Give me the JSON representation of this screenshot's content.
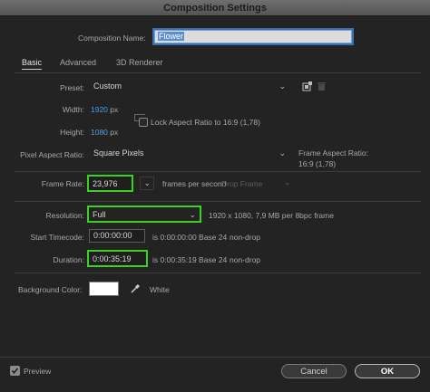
{
  "window": {
    "title": "Composition Settings"
  },
  "composition_name": {
    "label": "Composition Name:",
    "value": "Flower"
  },
  "tabs": [
    {
      "label": "Basic",
      "active": true
    },
    {
      "label": "Advanced",
      "active": false
    },
    {
      "label": "3D Renderer",
      "active": false
    }
  ],
  "preset": {
    "label": "Preset:",
    "value": "Custom"
  },
  "width": {
    "label": "Width:",
    "value": "1920",
    "unit": "px"
  },
  "height": {
    "label": "Height:",
    "value": "1080",
    "unit": "px"
  },
  "lock_aspect": {
    "label": "Lock Aspect Ratio to 16:9 (1,78)",
    "checked": false
  },
  "pixel_aspect": {
    "label": "Pixel Aspect Ratio:",
    "value": "Square Pixels"
  },
  "frame_aspect": {
    "label": "Frame Aspect Ratio:",
    "value": "16:9 (1,78)"
  },
  "frame_rate": {
    "label": "Frame Rate:",
    "value": "23,976",
    "unit": "frames per second",
    "drop_frame": "Drop Frame"
  },
  "resolution": {
    "label": "Resolution:",
    "value": "Full",
    "info": "1920 x 1080, 7,9 MB per 8bpc frame"
  },
  "start_timecode": {
    "label": "Start Timecode:",
    "value": "0:00:00:00",
    "info": "is 0:00:00:00  Base 24",
    "mode": "non-drop"
  },
  "duration": {
    "label": "Duration:",
    "value": "0:00:35:19",
    "info": "is 0:00:35:19  Base 24",
    "mode": "non-drop"
  },
  "background": {
    "label": "Background Color:",
    "color": "#FFFFFF",
    "name": "White"
  },
  "footer": {
    "preview_label": "Preview",
    "preview_checked": true,
    "cancel_label": "Cancel",
    "ok_label": "OK"
  },
  "colors": {
    "accent": "#4A9FE8",
    "highlight": "#39D21F",
    "background": "#232323"
  }
}
